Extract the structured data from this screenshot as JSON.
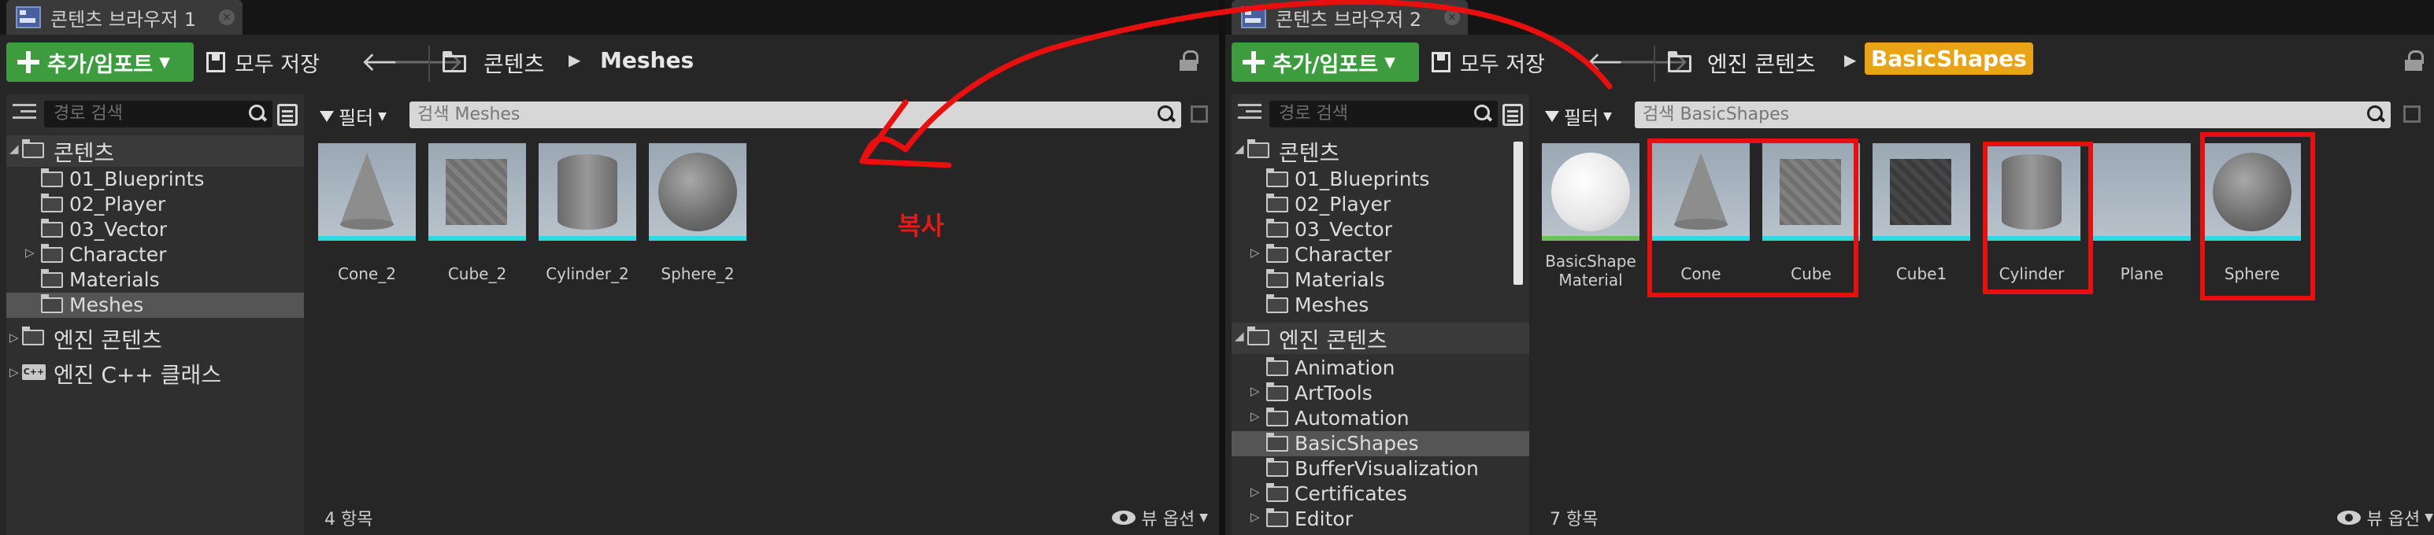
{
  "browser1": {
    "tab_title": "콘텐츠 브라우저 1",
    "add_import": "추가/임포트",
    "save_all": "모두 저장",
    "breadcrumb": [
      "콘텐츠",
      "Meshes"
    ],
    "tree_search_placeholder": "경로 검색",
    "tree": [
      {
        "label": "콘텐츠"
      },
      {
        "label": "01_Blueprints"
      },
      {
        "label": "02_Player"
      },
      {
        "label": "03_Vector"
      },
      {
        "label": "Character"
      },
      {
        "label": "Materials"
      },
      {
        "label": "Meshes"
      },
      {
        "label": "엔진 콘텐츠"
      },
      {
        "label": "엔진 C++ 클래스"
      }
    ],
    "filter_label": "필터",
    "asset_search_placeholder": "검색 Meshes",
    "assets": [
      {
        "label": "Cone_2",
        "shape": "cone"
      },
      {
        "label": "Cube_2",
        "shape": "cube"
      },
      {
        "label": "Cylinder_2",
        "shape": "cylinder"
      },
      {
        "label": "Sphere_2",
        "shape": "sphere"
      }
    ],
    "item_count": "4 항목",
    "view_options": "뷰 옵션"
  },
  "browser2": {
    "tab_title": "콘텐츠 브라우저 2",
    "add_import": "추가/임포트",
    "save_all": "모두 저장",
    "breadcrumb": [
      "엔진 콘텐츠",
      "BasicShapes"
    ],
    "tree_search_placeholder": "경로 검색",
    "tree": [
      {
        "label": "콘텐츠"
      },
      {
        "label": "01_Blueprints"
      },
      {
        "label": "02_Player"
      },
      {
        "label": "03_Vector"
      },
      {
        "label": "Character"
      },
      {
        "label": "Materials"
      },
      {
        "label": "Meshes"
      },
      {
        "label": "엔진 콘텐츠"
      },
      {
        "label": "Animation"
      },
      {
        "label": "ArtTools"
      },
      {
        "label": "Automation"
      },
      {
        "label": "BasicShapes"
      },
      {
        "label": "BufferVisualization"
      },
      {
        "label": "Certificates"
      },
      {
        "label": "Editor"
      }
    ],
    "filter_label": "필터",
    "asset_search_placeholder": "검색 BasicShapes",
    "assets": [
      {
        "label": "BasicShape Material",
        "shape": "material-sphere"
      },
      {
        "label": "Cone",
        "shape": "cone"
      },
      {
        "label": "Cube",
        "shape": "cube"
      },
      {
        "label": "Cube1",
        "shape": "cube-dark"
      },
      {
        "label": "Cylinder",
        "shape": "cylinder"
      },
      {
        "label": "Plane",
        "shape": "plane"
      },
      {
        "label": "Sphere",
        "shape": "sphere"
      }
    ],
    "item_count": "7 항목",
    "view_options": "뷰 옵션"
  },
  "annotation": {
    "copy_label": "복사",
    "color": "#e80f0f"
  },
  "colors": {
    "accent_green": "#3d9c3d",
    "breadcrumb_active": "#e8a317",
    "mesh_strip": "#30d8e0",
    "material_strip": "#6ac25a"
  }
}
